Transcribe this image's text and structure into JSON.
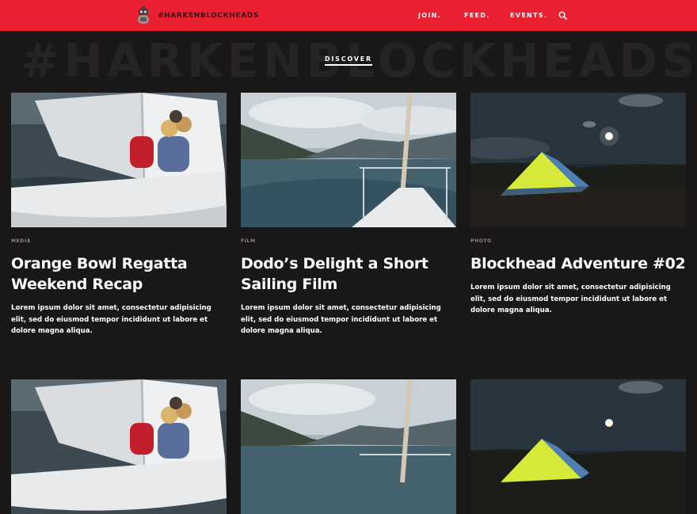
{
  "header": {
    "brand": "#HARKENBLOCKHEADS",
    "nav": [
      "JOIN.",
      "FEED.",
      "EVENTS."
    ],
    "accent_color": "#e8202f",
    "logo_icon": "blockhead-mascot-icon",
    "search_icon": "search-icon"
  },
  "hero": {
    "watermark": "#HARKENBLOCKHEADS",
    "section_label": "DISCOVER"
  },
  "posts": [
    {
      "category": "MEDIA",
      "title": "Orange Bowl Regatta Weekend Recap",
      "excerpt": "Lorem ipsum dolor sit amet, consectetur adipisicing elit, sed do eiusmod tempor incididunt ut labore et dolore magna aliqua.",
      "image": "sailboat-crew-photo"
    },
    {
      "category": "FILM",
      "title": "Dodo’s Delight a Short Sailing Film",
      "excerpt": "Lorem ipsum dolor sit amet, consectetur adipisicing elit, sed do eiusmod tempor incididunt ut labore et dolore magna aliqua.",
      "image": "bow-view-mountains-photo"
    },
    {
      "category": "PHOTO",
      "title": "Blockhead Adventure #02",
      "excerpt": "Lorem ipsum dolor sit amet, consectetur adipisicing elit, sed do eiusmod tempor incididunt ut labore et dolore magna aliqua.",
      "image": "night-tent-photo"
    }
  ]
}
